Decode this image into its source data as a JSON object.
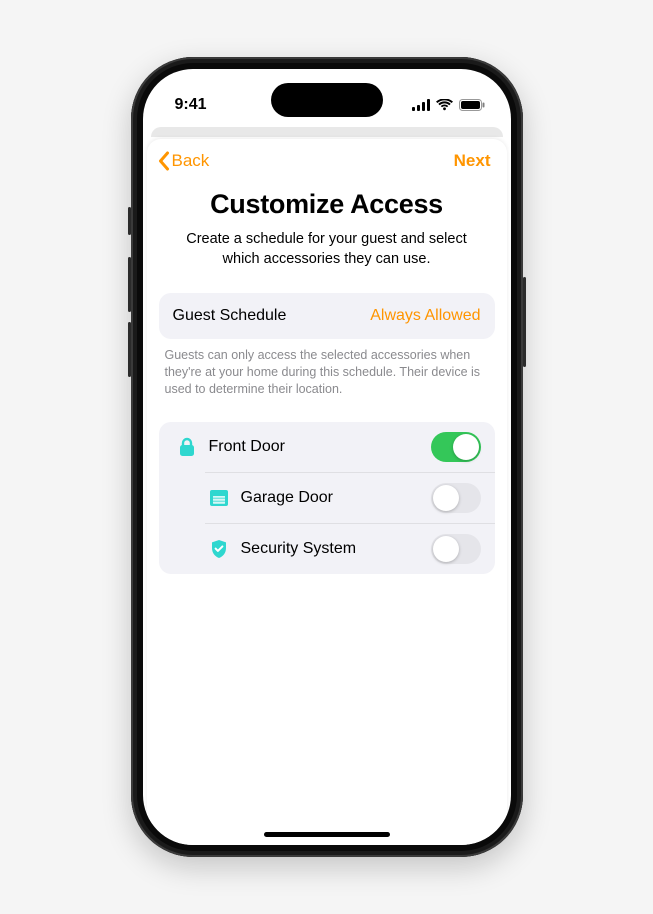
{
  "status": {
    "time": "9:41"
  },
  "nav": {
    "back_label": "Back",
    "next_label": "Next"
  },
  "header": {
    "title": "Customize Access",
    "subtitle": "Create a schedule for your guest and select which accessories they can use."
  },
  "schedule": {
    "label": "Guest Schedule",
    "value": "Always Allowed",
    "footnote": "Guests can only access the selected accessories when they're at your home during this schedule. Their device is used to determine their location."
  },
  "accessories": [
    {
      "icon": "lock",
      "label": "Front Door",
      "on": true
    },
    {
      "icon": "garage",
      "label": "Garage Door",
      "on": false
    },
    {
      "icon": "shield",
      "label": "Security System",
      "on": false
    }
  ],
  "colors": {
    "accent_orange": "#ff9500",
    "toggle_on": "#34c759",
    "icon_teal": "#2fd7cf"
  }
}
